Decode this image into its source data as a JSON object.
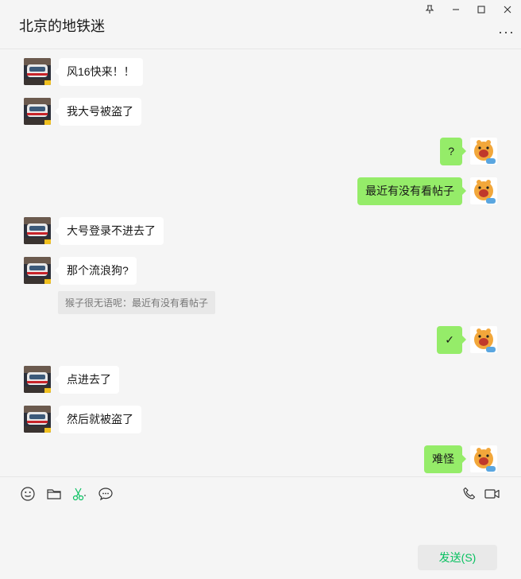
{
  "window": {
    "title": "北京的地铁迷",
    "more_label": "···"
  },
  "messages": [
    {
      "side": "left",
      "text": "风16快来！！",
      "avatar": "subway-train-avatar"
    },
    {
      "side": "left",
      "text": "我大号被盗了",
      "avatar": "subway-train-avatar"
    },
    {
      "side": "right",
      "text": "?",
      "avatar": "cartoon-giraffe-avatar"
    },
    {
      "side": "right",
      "text": "最近有没有看帖子",
      "avatar": "cartoon-giraffe-avatar"
    },
    {
      "side": "left",
      "text": "大号登录不进去了",
      "avatar": "subway-train-avatar"
    },
    {
      "side": "left",
      "text": "那个流浪狗?",
      "avatar": "subway-train-avatar"
    },
    {
      "side": "right",
      "text": "✓",
      "avatar": "cartoon-giraffe-avatar"
    },
    {
      "side": "left",
      "text": "点进去了",
      "avatar": "subway-train-avatar"
    },
    {
      "side": "left",
      "text": "然后就被盗了",
      "avatar": "subway-train-avatar"
    },
    {
      "side": "right",
      "text": "难怪",
      "avatar": "cartoon-giraffe-avatar"
    }
  ],
  "quote": {
    "text": "猴子很无语呢：最近有没有看帖子"
  },
  "input_area": {
    "send_label": "发送(S)"
  },
  "colors": {
    "self_bubble": "#95ec69",
    "other_bubble": "#ffffff",
    "send_text": "#07c160",
    "background": "#f5f5f5"
  }
}
